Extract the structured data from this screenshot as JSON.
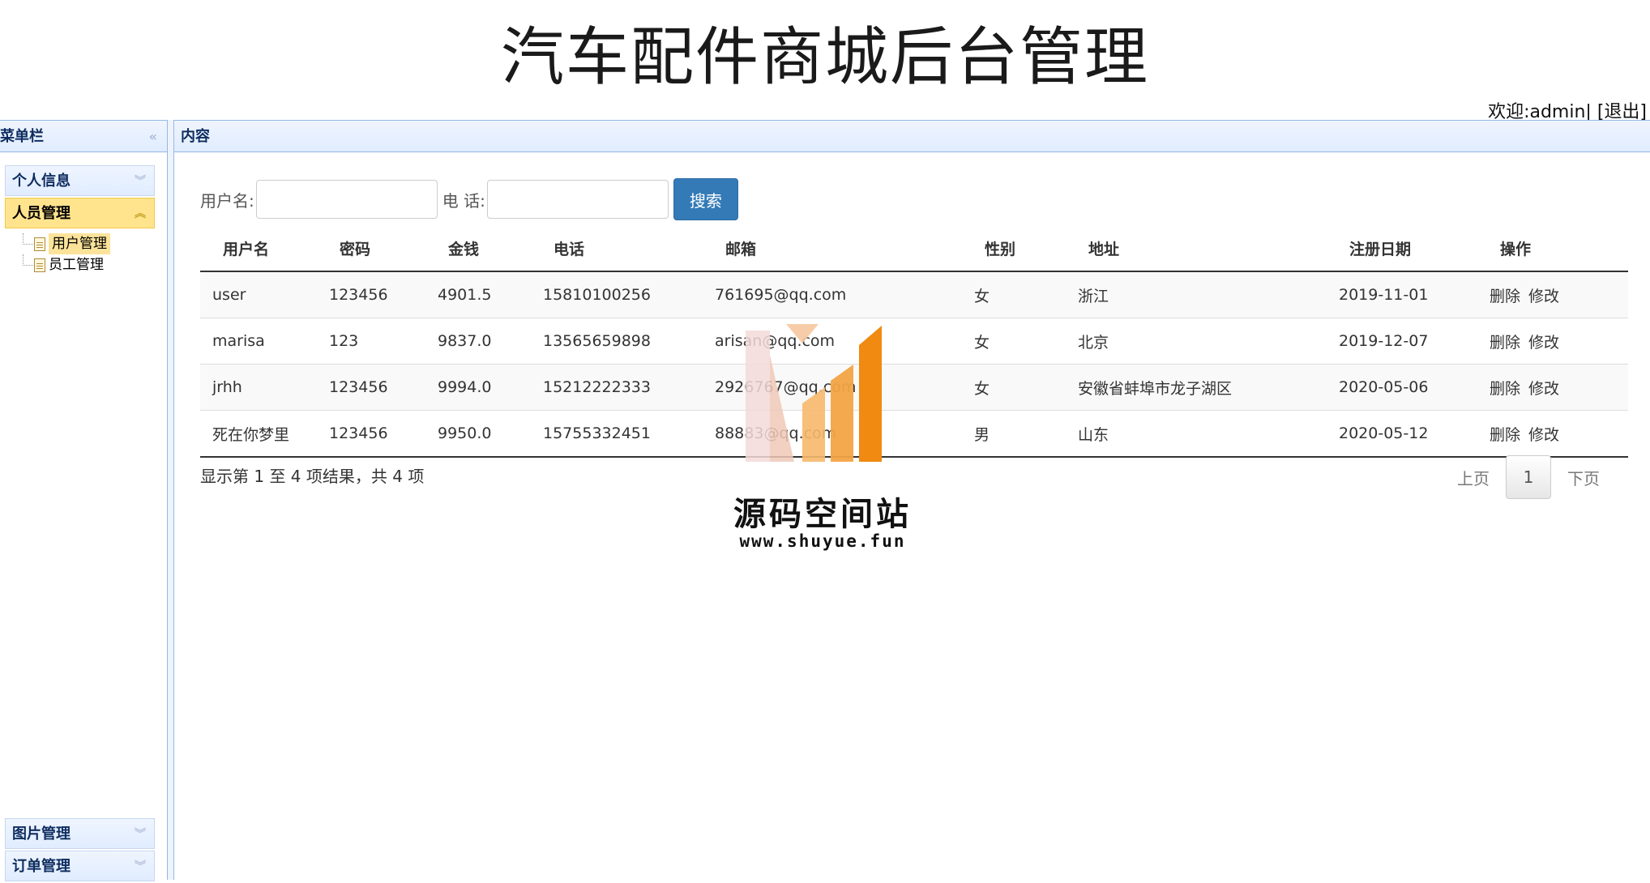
{
  "header": {
    "title": "汽车配件商城后台管理",
    "welcome": "欢迎:admin|",
    "logout": "[退出]"
  },
  "sidebar": {
    "title": "菜单栏",
    "sections": [
      {
        "label": "个人信息",
        "expanded": false
      },
      {
        "label": "人员管理",
        "expanded": true,
        "children": [
          "用户管理",
          "员工管理"
        ],
        "selected": "用户管理"
      },
      {
        "label": "图片管理",
        "expanded": false
      },
      {
        "label": "订单管理",
        "expanded": false
      }
    ]
  },
  "content": {
    "title": "内容",
    "search": {
      "username_label": "用户名:",
      "username_value": "",
      "phone_label": "电 话:",
      "phone_value": "",
      "button": "搜索"
    },
    "table": {
      "columns": [
        "用户名",
        "密码",
        "金钱",
        "电话",
        "邮箱",
        "性别",
        "地址",
        "注册日期",
        "操作"
      ],
      "rows": [
        [
          "user",
          "123456",
          "4901.5",
          "15810100256",
          "761695@qq.com",
          "女",
          "浙江",
          "2019-11-01"
        ],
        [
          "marisa",
          "123",
          "9837.0",
          "13565659898",
          "arisan@qq.com",
          "女",
          "北京",
          "2019-12-07"
        ],
        [
          "jrhh",
          "123456",
          "9994.0",
          "15212222333",
          "2926767@qq.com",
          "女",
          "安徽省蚌埠市龙子湖区",
          "2020-05-06"
        ],
        [
          "死在你梦里",
          "123456",
          "9950.0",
          "15755332451",
          "88883@qq.com",
          "男",
          "山东",
          "2020-05-12"
        ]
      ],
      "actions": [
        "删除",
        "修改"
      ]
    },
    "summary": "显示第 1 至 4 项结果，共 4 项",
    "pager": {
      "prev": "上页",
      "current": "1",
      "next": "下页"
    }
  },
  "watermark": {
    "name": "源码空间站",
    "url": "www.shuyue.fun"
  },
  "colors": {
    "accent": "#337ab7",
    "panel_border": "#95b8e7",
    "selected": "#fbe39a",
    "watermark_orange": "#f39a2a"
  }
}
